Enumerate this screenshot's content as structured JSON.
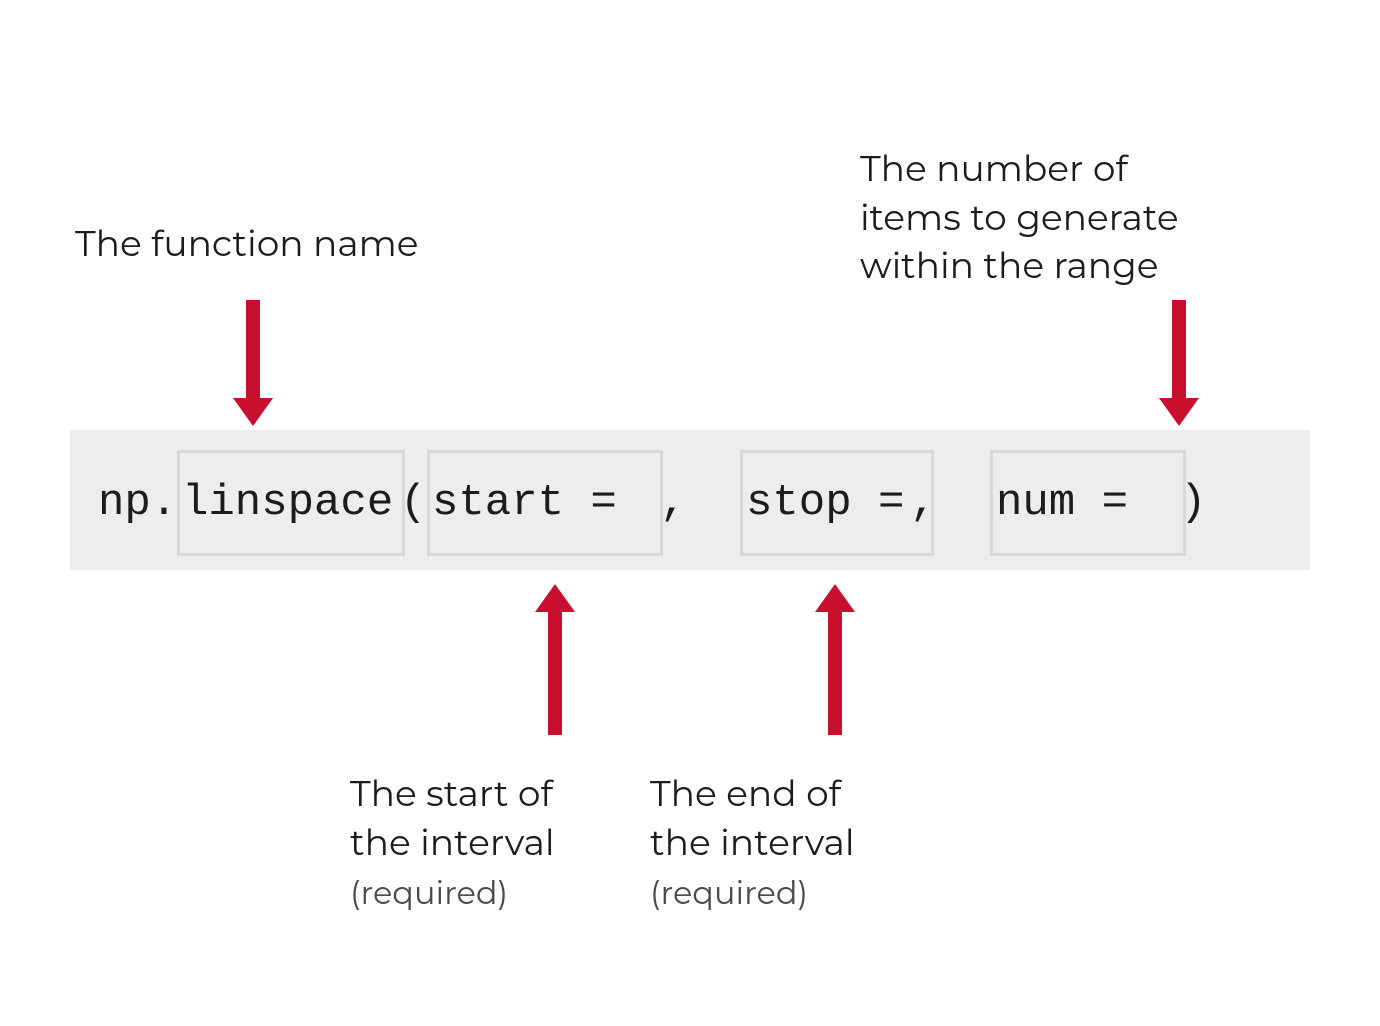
{
  "labels": {
    "fn": "The function name",
    "num": "The number of\nitems to generate\nwithin the range",
    "start_main": "The start of\nthe interval",
    "start_sub": "(required)",
    "stop_main": "The end of\nthe interval",
    "stop_sub": "(required)"
  },
  "code": {
    "prefix": "np.",
    "fn_name": "linspace",
    "open": "(",
    "start_kw": "start = ",
    "sep1": ", ",
    "stop_kw": "stop =",
    "sep2": ", ",
    "num_kw": "num = ",
    "close": ")"
  },
  "colors": {
    "accent": "#c8102e",
    "code_bg": "#ededed",
    "box_border": "#d8d8d8"
  }
}
